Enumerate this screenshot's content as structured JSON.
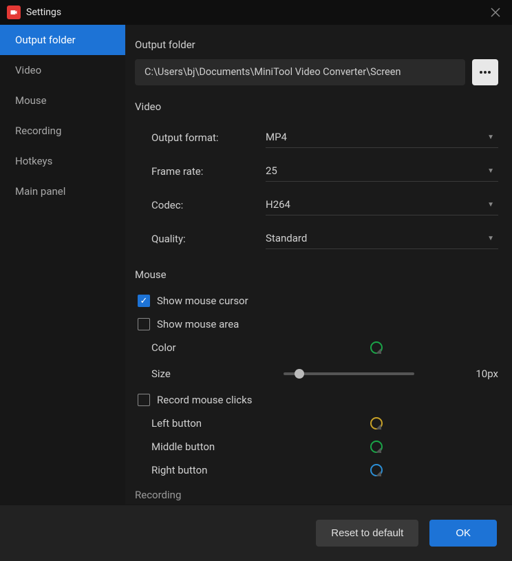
{
  "window": {
    "title": "Settings"
  },
  "sidebar": {
    "items": [
      {
        "label": "Output folder",
        "active": true
      },
      {
        "label": "Video",
        "active": false
      },
      {
        "label": "Mouse",
        "active": false
      },
      {
        "label": "Recording",
        "active": false
      },
      {
        "label": "Hotkeys",
        "active": false
      },
      {
        "label": "Main panel",
        "active": false
      }
    ]
  },
  "sections": {
    "output_folder": {
      "title": "Output folder",
      "path": "C:\\Users\\bj\\Documents\\MiniTool Video Converter\\Screen"
    },
    "video": {
      "title": "Video",
      "output_format": {
        "label": "Output format:",
        "value": "MP4"
      },
      "frame_rate": {
        "label": "Frame rate:",
        "value": "25"
      },
      "codec": {
        "label": "Codec:",
        "value": "H264"
      },
      "quality": {
        "label": "Quality:",
        "value": "Standard"
      }
    },
    "mouse": {
      "title": "Mouse",
      "show_cursor": {
        "label": "Show mouse cursor",
        "checked": true
      },
      "show_area": {
        "label": "Show mouse area",
        "checked": false
      },
      "color": {
        "label": "Color",
        "value": "#1aa548"
      },
      "size": {
        "label": "Size",
        "value_text": "10px",
        "percent": 12
      },
      "record_clicks": {
        "label": "Record mouse clicks",
        "checked": false
      },
      "left_button": {
        "label": "Left button",
        "color": "#c9a227"
      },
      "middle_button": {
        "label": "Middle button",
        "color": "#1aa548"
      },
      "right_button": {
        "label": "Right button",
        "color": "#2b8fd6"
      }
    },
    "recording": {
      "title": "Recording"
    }
  },
  "footer": {
    "reset": "Reset to default",
    "ok": "OK"
  }
}
